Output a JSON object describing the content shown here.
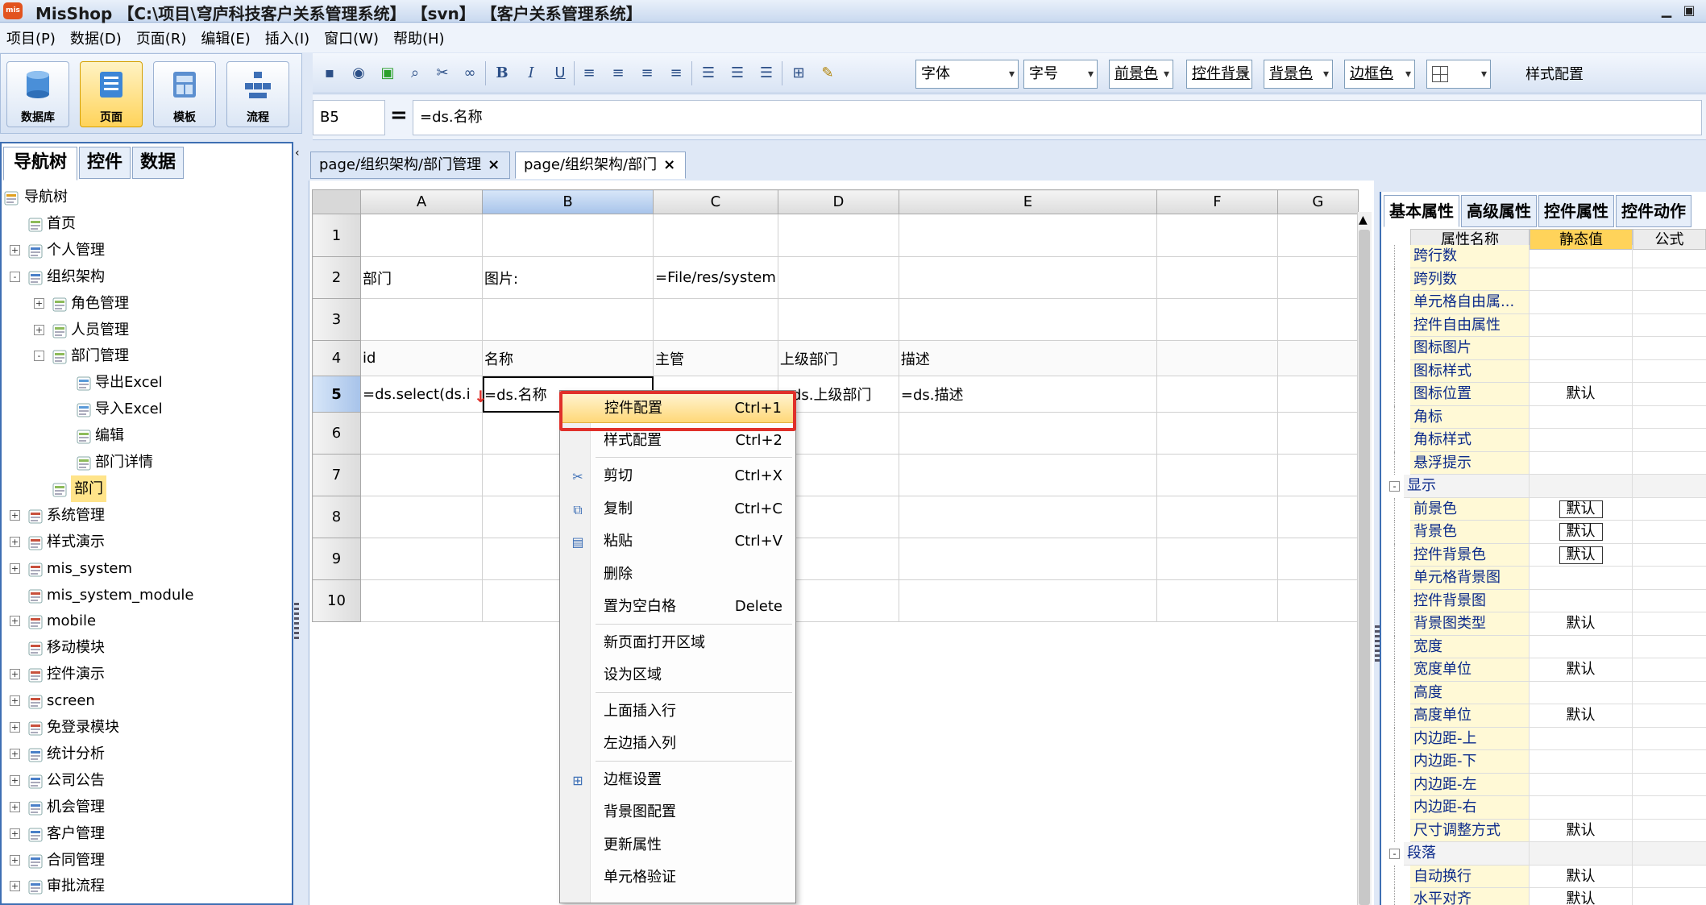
{
  "titlebar": {
    "logo": "mis",
    "title": "MisShop 【C:\\项目\\穹庐科技客户关系管理系统】 【svn】 【客户关系管理系统】",
    "minimize": "▁",
    "maximize": "▣"
  },
  "menubar": [
    "项目(P)",
    "数据(D)",
    "页面(R)",
    "编辑(E)",
    "插入(I)",
    "窗口(W)",
    "帮助(H)"
  ],
  "bigbuttons": [
    {
      "label": "数据库",
      "icon": "database-icon"
    },
    {
      "label": "页面",
      "icon": "page-icon",
      "active": true
    },
    {
      "label": "模板",
      "icon": "template-icon"
    },
    {
      "label": "流程",
      "icon": "flow-icon"
    }
  ],
  "toolbar": {
    "bold": "B",
    "italic": "I",
    "underline": "U",
    "font": "字体",
    "fontsize": "字号",
    "fg": "前景色",
    "ctrlbg": "控件背景",
    "bg": "背景色",
    "border": "边框色",
    "borderstyle": "",
    "style_config": "样式配置"
  },
  "formula": {
    "cell": "B5",
    "eq": "=",
    "value": "=ds.名称"
  },
  "leftpanel": {
    "tabs": [
      "导航树",
      "控件",
      "数据"
    ],
    "tree": [
      {
        "label": "导航树",
        "level": 0,
        "exp": "",
        "icon": "folder"
      },
      {
        "label": "首页",
        "level": 1,
        "exp": "",
        "icon": "page"
      },
      {
        "label": "个人管理",
        "level": 1,
        "exp": "+",
        "icon": "list"
      },
      {
        "label": "组织架构",
        "level": 1,
        "exp": "-",
        "icon": "list"
      },
      {
        "label": "角色管理",
        "level": 2,
        "exp": "+",
        "icon": "page"
      },
      {
        "label": "人员管理",
        "level": 2,
        "exp": "+",
        "icon": "page"
      },
      {
        "label": "部门管理",
        "level": 2,
        "exp": "-",
        "icon": "page"
      },
      {
        "label": "导出Excel",
        "level": 3,
        "exp": "",
        "icon": "pagex"
      },
      {
        "label": "导入Excel",
        "level": 3,
        "exp": "",
        "icon": "pagex"
      },
      {
        "label": "编辑",
        "level": 3,
        "exp": "",
        "icon": "page"
      },
      {
        "label": "部门详情",
        "level": 3,
        "exp": "",
        "icon": "page"
      },
      {
        "label": "部门",
        "level": 2,
        "exp": "",
        "icon": "page",
        "selected": true
      },
      {
        "label": "系统管理",
        "level": 1,
        "exp": "+",
        "icon": "edit"
      },
      {
        "label": "样式演示",
        "level": 1,
        "exp": "+",
        "icon": "edit"
      },
      {
        "label": "mis_system",
        "level": 1,
        "exp": "+",
        "icon": "edit"
      },
      {
        "label": "mis_system_module",
        "level": 1,
        "exp": "",
        "icon": "edit"
      },
      {
        "label": "mobile",
        "level": 1,
        "exp": "+",
        "icon": "edit"
      },
      {
        "label": "移动模块",
        "level": 1,
        "exp": "",
        "icon": "edit"
      },
      {
        "label": "控件演示",
        "level": 1,
        "exp": "+",
        "icon": "edit"
      },
      {
        "label": "screen",
        "level": 1,
        "exp": "+",
        "icon": "edit"
      },
      {
        "label": "免登录模块",
        "level": 1,
        "exp": "+",
        "icon": "edit"
      },
      {
        "label": "统计分析",
        "level": 1,
        "exp": "+",
        "icon": "list"
      },
      {
        "label": "公司公告",
        "level": 1,
        "exp": "+",
        "icon": "list"
      },
      {
        "label": "机会管理",
        "level": 1,
        "exp": "+",
        "icon": "list"
      },
      {
        "label": "客户管理",
        "level": 1,
        "exp": "+",
        "icon": "list"
      },
      {
        "label": "合同管理",
        "level": 1,
        "exp": "+",
        "icon": "list"
      },
      {
        "label": "审批流程",
        "level": 1,
        "exp": "+",
        "icon": "list"
      }
    ]
  },
  "doctabs": [
    {
      "label": "page/组织架构/部门管理",
      "close": "×"
    },
    {
      "label": "page/组织架构/部门",
      "close": "×",
      "active": true
    }
  ],
  "grid": {
    "columns": [
      "A",
      "B",
      "C",
      "D",
      "E",
      "F",
      "G"
    ],
    "selected_col": "B",
    "selected_row": "5",
    "rows": [
      {
        "num": "1",
        "cells": [
          "",
          "",
          "",
          "",
          "",
          "",
          ""
        ]
      },
      {
        "num": "2",
        "cells": [
          "部门",
          "图片:",
          "=File/res/system",
          "",
          "",
          "",
          ""
        ]
      },
      {
        "num": "3",
        "cells": [
          "",
          "",
          "",
          "",
          "",
          "",
          ""
        ]
      },
      {
        "num": "4",
        "cells": [
          "id",
          "名称",
          "主管",
          "上级部门",
          "描述",
          "",
          ""
        ]
      },
      {
        "num": "5",
        "cells": [
          "=ds.select(ds.i",
          "=ds.名称",
          "",
          "=ds.上级部门",
          " =ds.描述",
          "",
          ""
        ]
      },
      {
        "num": "6",
        "cells": [
          "",
          "",
          "",
          "",
          "",
          "",
          ""
        ]
      },
      {
        "num": "7",
        "cells": [
          "",
          "",
          "",
          "",
          "",
          "",
          ""
        ]
      },
      {
        "num": "8",
        "cells": [
          "",
          "",
          "",
          "",
          "",
          "",
          ""
        ]
      },
      {
        "num": "9",
        "cells": [
          "",
          "",
          "",
          "",
          "",
          "",
          ""
        ]
      },
      {
        "num": "10",
        "cells": [
          "",
          "",
          "",
          "",
          "",
          "",
          ""
        ]
      }
    ]
  },
  "contextmenu": [
    {
      "label": "控件配置",
      "shortcut": "Ctrl+1",
      "highlight": true
    },
    {
      "label": "样式配置",
      "shortcut": "Ctrl+2",
      "sepAfter": true
    },
    {
      "label": "剪切",
      "shortcut": "Ctrl+X",
      "icon": "scissors-icon"
    },
    {
      "label": "复制",
      "shortcut": "Ctrl+C",
      "icon": "copy-icon"
    },
    {
      "label": "粘贴",
      "shortcut": "Ctrl+V",
      "icon": "paste-icon"
    },
    {
      "label": "删除",
      "shortcut": ""
    },
    {
      "label": "置为空白格",
      "shortcut": "Delete",
      "sepAfter": true
    },
    {
      "label": "新页面打开区域",
      "shortcut": ""
    },
    {
      "label": "设为区域",
      "shortcut": "",
      "sepAfter": true
    },
    {
      "label": "上面插入行",
      "shortcut": ""
    },
    {
      "label": "左边插入列",
      "shortcut": "",
      "sepAfter": true
    },
    {
      "label": "边框设置",
      "shortcut": "",
      "icon": "border-icon"
    },
    {
      "label": "背景图配置",
      "shortcut": ""
    },
    {
      "label": "更新属性",
      "shortcut": ""
    },
    {
      "label": "单元格验证",
      "shortcut": ""
    }
  ],
  "rightpanel": {
    "tabs": [
      "基本属性",
      "高级属性",
      "控件属性",
      "控件动作"
    ],
    "header": {
      "name": "属性名称",
      "value": "静态值",
      "formula": "公式"
    },
    "props": [
      {
        "name": "跨行数",
        "value": ""
      },
      {
        "name": "跨列数",
        "value": ""
      },
      {
        "name": "单元格自由属...",
        "value": ""
      },
      {
        "name": "控件自由属性",
        "value": ""
      },
      {
        "name": "图标图片",
        "value": ""
      },
      {
        "name": "图标样式",
        "value": ""
      },
      {
        "name": "图标位置",
        "value": "默认"
      },
      {
        "name": "角标",
        "value": ""
      },
      {
        "name": "角标样式",
        "value": ""
      },
      {
        "name": "悬浮提示",
        "value": ""
      },
      {
        "name": "显示",
        "value": "",
        "group": true
      },
      {
        "name": "前景色",
        "value": "默认",
        "boxed": true
      },
      {
        "name": "背景色",
        "value": "默认",
        "boxed": true
      },
      {
        "name": "控件背景色",
        "value": "默认",
        "boxed": true
      },
      {
        "name": "单元格背景图",
        "value": ""
      },
      {
        "name": "控件背景图",
        "value": ""
      },
      {
        "name": "背景图类型",
        "value": "默认"
      },
      {
        "name": "宽度",
        "value": ""
      },
      {
        "name": "宽度单位",
        "value": "默认"
      },
      {
        "name": "高度",
        "value": ""
      },
      {
        "name": "高度单位",
        "value": "默认"
      },
      {
        "name": "内边距-上",
        "value": ""
      },
      {
        "name": "内边距-下",
        "value": ""
      },
      {
        "name": "内边距-左",
        "value": ""
      },
      {
        "name": "内边距-右",
        "value": ""
      },
      {
        "name": "尺寸调整方式",
        "value": "默认"
      },
      {
        "name": "段落",
        "value": "",
        "group": true
      },
      {
        "name": "自动换行",
        "value": "默认"
      },
      {
        "name": "水平对齐",
        "value": "默认"
      }
    ]
  }
}
